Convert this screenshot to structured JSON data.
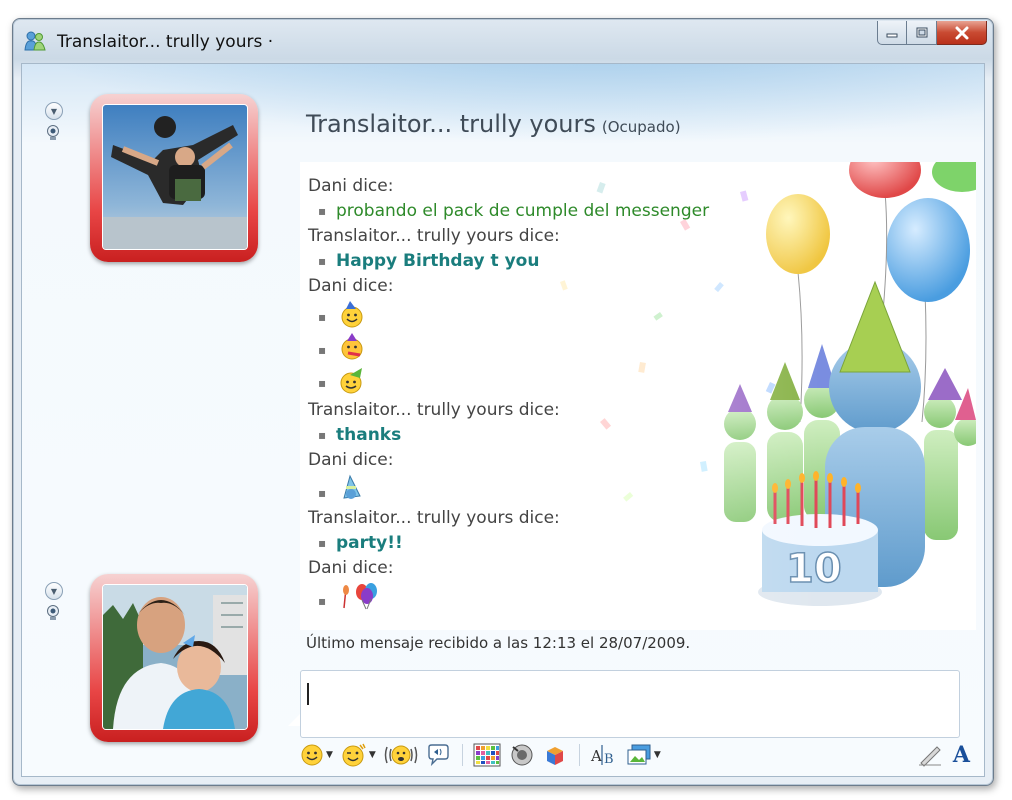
{
  "window": {
    "title": "Translaitor... trully yours ·",
    "buttons": {
      "minimize": "minimize-icon",
      "maximize": "maximize-icon",
      "close": "close-icon"
    }
  },
  "contact": {
    "name": "Translaitor... trully yours",
    "status": "(Ocupado)"
  },
  "conversation": [
    {
      "kind": "sender",
      "text": "Dani dice:"
    },
    {
      "kind": "message",
      "style": "green",
      "text": "probando el pack de cumple del messenger"
    },
    {
      "kind": "sender",
      "text": "Translaitor... trully yours dice:"
    },
    {
      "kind": "message",
      "style": "teal",
      "text": "Happy Birthday t you"
    },
    {
      "kind": "sender",
      "text": "Dani dice:"
    },
    {
      "kind": "emoticon",
      "icon": "party-hat-smiley-icon"
    },
    {
      "kind": "emoticon",
      "icon": "party-blower-smiley-icon"
    },
    {
      "kind": "emoticon",
      "icon": "green-hat-smiley-icon"
    },
    {
      "kind": "sender",
      "text": "Translaitor... trully yours dice:"
    },
    {
      "kind": "message",
      "style": "teal",
      "text": "thanks"
    },
    {
      "kind": "sender",
      "text": "Dani dice:"
    },
    {
      "kind": "emoticon",
      "icon": "party-hat-icon"
    },
    {
      "kind": "sender",
      "text": "Translaitor... trully yours dice:"
    },
    {
      "kind": "message",
      "style": "teal",
      "text": "party!!"
    },
    {
      "kind": "sender",
      "text": "Dani dice:"
    },
    {
      "kind": "emoticon",
      "icon": "balloons-icon"
    }
  ],
  "last_message": "Último mensaje recibido a las 12:13 el 28/07/2009.",
  "input": {
    "value": ""
  },
  "toolbar": {
    "items": [
      "emoticon-icon",
      "wink-icon",
      "nudge-icon",
      "voice-clip-icon",
      "background-icon",
      "sound-icon",
      "game-icon",
      "translate-icon",
      "share-photos-icon"
    ],
    "right_items": [
      "handwriting-icon",
      "font-icon"
    ],
    "font_label": "A"
  },
  "colors": {
    "accent": "#1a7d7d",
    "green_text": "#2e8a2a",
    "avatar_frame": "#e84545",
    "close_button": "#c94a32"
  }
}
